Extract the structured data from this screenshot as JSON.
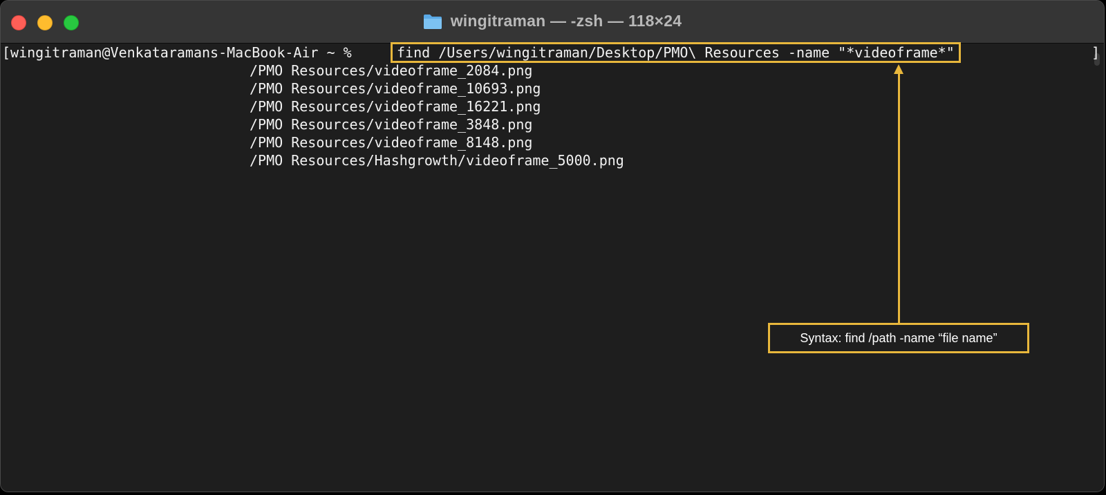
{
  "window": {
    "title": "wingitraman — -zsh — 118×24",
    "folder_icon": "folder-icon",
    "traffic_lights": {
      "close": "#ff5f57",
      "minimize": "#febc2e",
      "maximize": "#28c840"
    }
  },
  "terminal": {
    "prompt": "[wingitraman@Venkataramans-MacBook-Air ~ % ",
    "command": "find /Users/wingitraman/Desktop/PMO\\ Resources -name \"*videoframe*\"",
    "right_bracket": "]",
    "output_lines": [
      "/PMO Resources/videoframe_2084.png",
      "/PMO Resources/videoframe_10693.png",
      "/PMO Resources/videoframe_16221.png",
      "/PMO Resources/videoframe_3848.png",
      "/PMO Resources/videoframe_8148.png",
      "/PMO Resources/Hashgrowth/videoframe_5000.png"
    ]
  },
  "annotation": {
    "syntax_text": "Syntax: find /path -name “file name”",
    "accent_color": "#e8b73c"
  }
}
